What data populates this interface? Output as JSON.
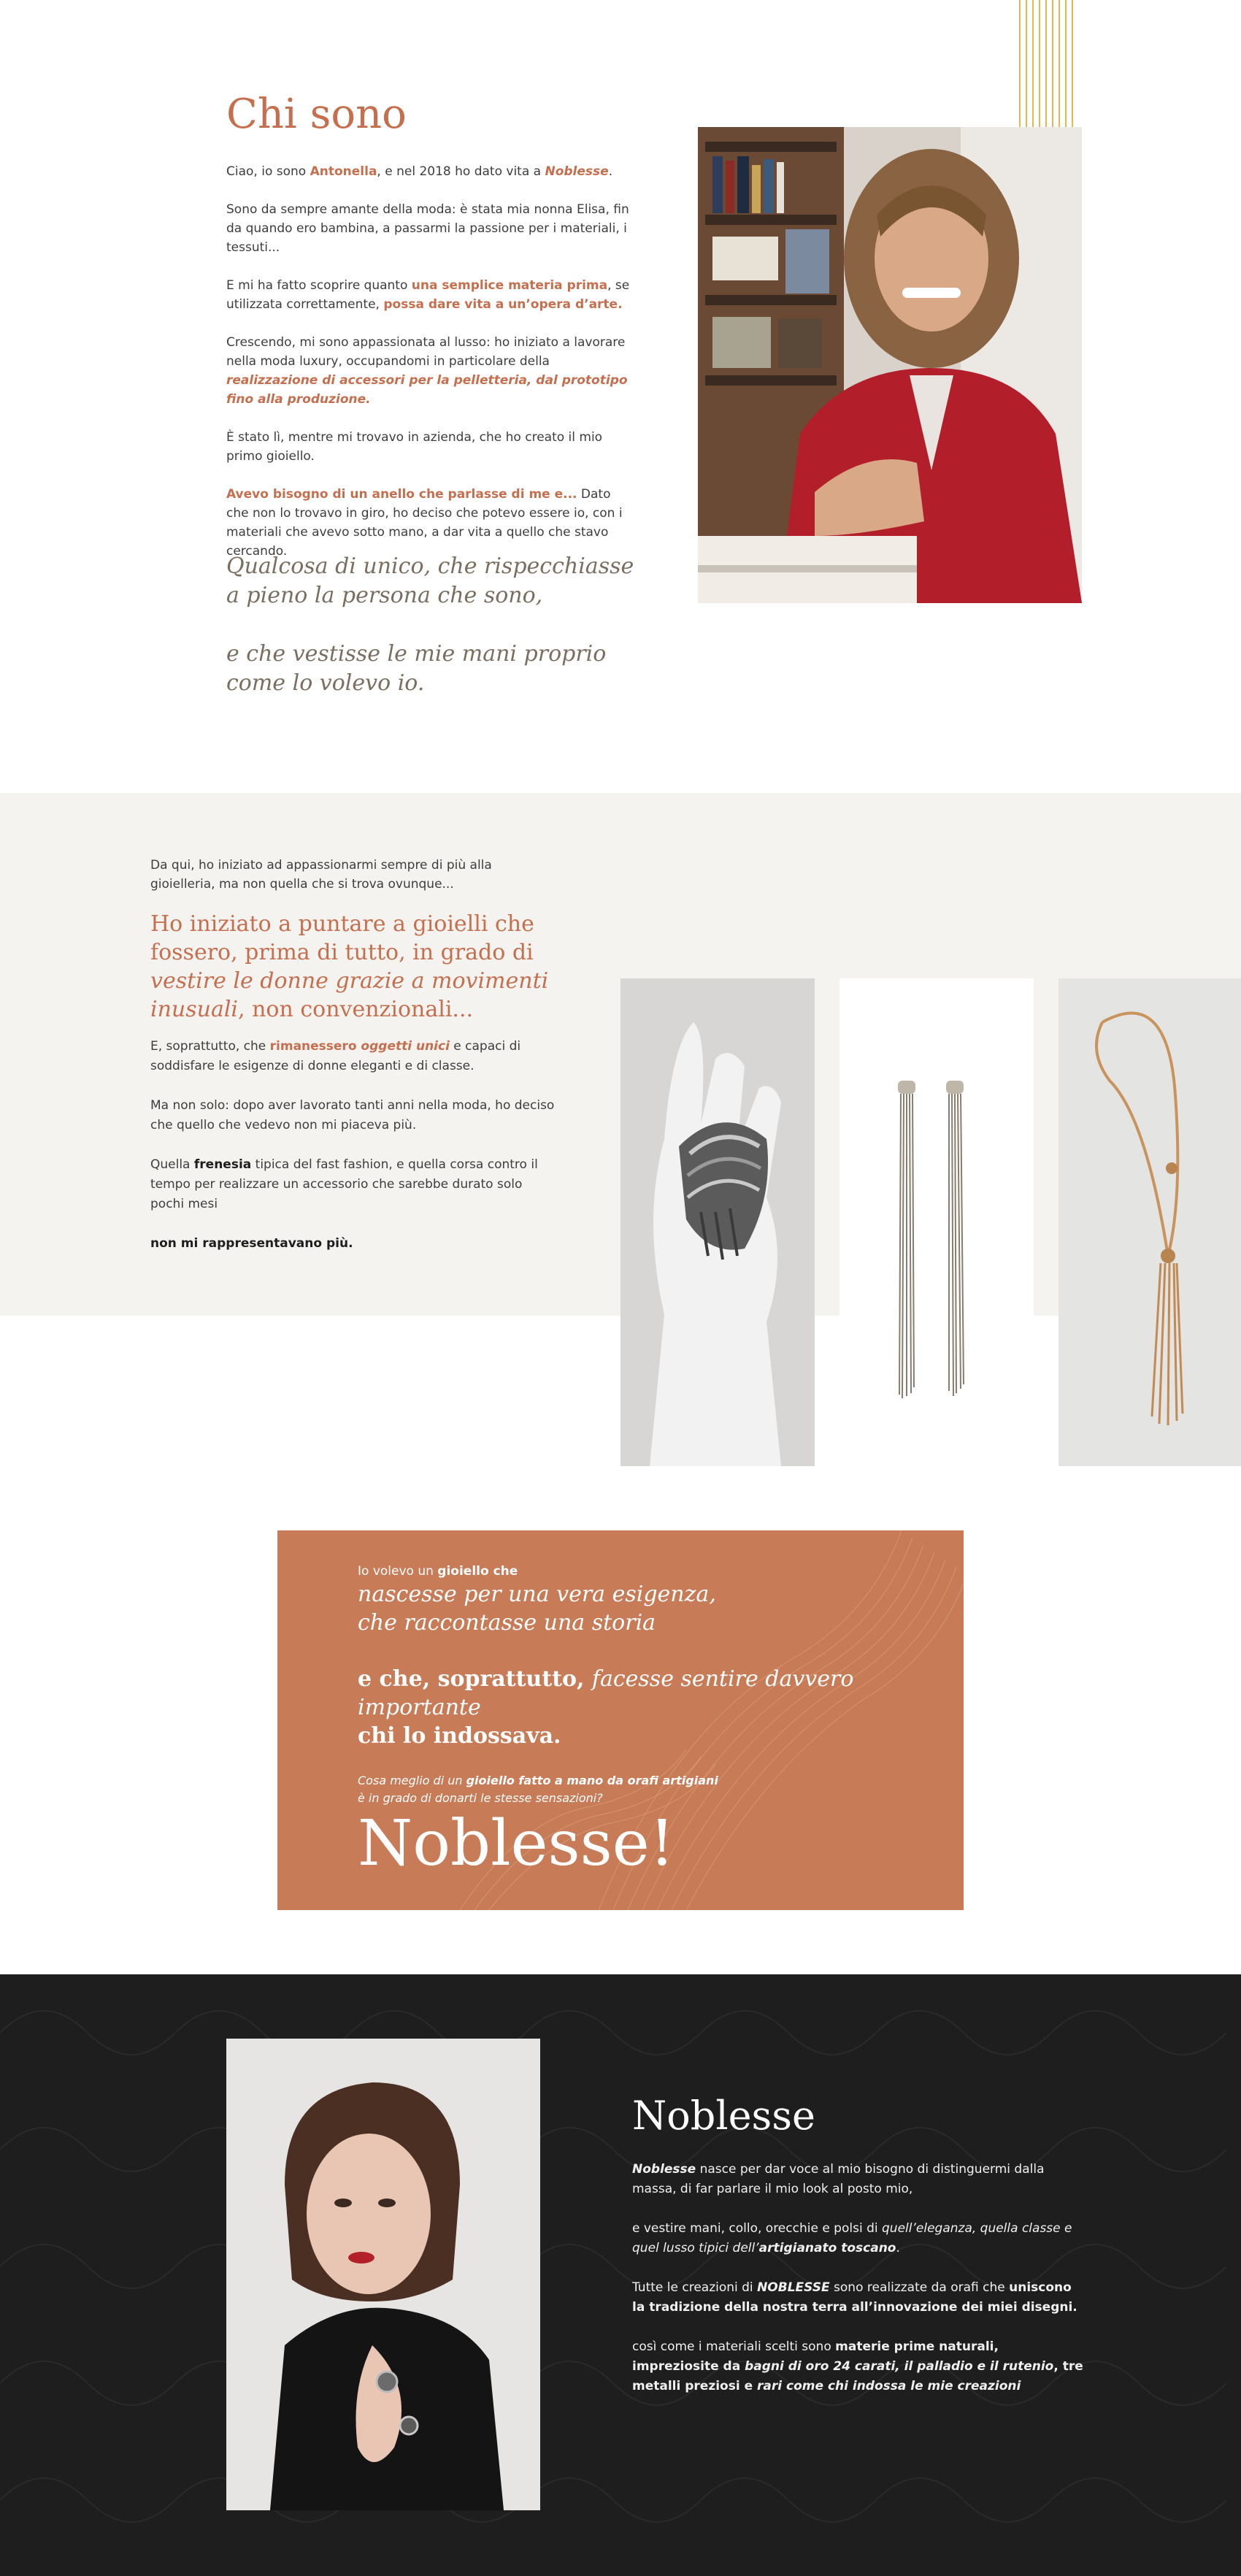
{
  "about": {
    "title": "Chi sono",
    "p1_a": "Ciao, io sono ",
    "p1_name": "Antonella",
    "p1_b": ", e nel 2018 ho dato vita a ",
    "p1_brand": "Noblesse",
    "p1_c": ".",
    "p2": "Sono da sempre amante della moda: è stata mia nonna Elisa, fin da quando ero bambina, a passarmi la passione per i materiali, i tessuti...",
    "p3_a": "E mi ha fatto scoprire quanto ",
    "p3_b": "una semplice materia prima",
    "p3_c": ", se utilizzata correttamente, ",
    "p3_d": "possa dare vita a un’opera d’arte.",
    "p4_a": "Crescendo, mi sono appassionata al lusso: ho iniziato a lavorare nella moda luxury, occupandomi in particolare della ",
    "p4_b": "realizzazione di accessori per la pelletteria, dal prototipo fino alla produzione.",
    "p5": "È stato lì, mentre mi trovavo in azienda, che ho creato il mio primo gioiello.",
    "p6_a": "Avevo bisogno di un anello che parlasse di me e...",
    "p6_b": " Dato che non lo trovavo in giro, ho deciso che potevo essere io, con i materiali che avevo sotto mano, a dar vita a quello che stavo cercando.",
    "quote1": "Qualcosa di unico, che rispecchiasse a pieno la persona che sono,",
    "quote2": "e che vestisse le mie mani proprio come lo volevo io."
  },
  "journey": {
    "intro": "Da qui, ho iniziato ad appassionarmi sempre di più alla gioielleria, ma non quella che si trova ovunque...",
    "head_a": "Ho iniziato a puntare a gioielli che fossero, prima di tutto, in grado di ",
    "head_b": "vestire le donne grazie a movimenti inusuali",
    "head_c": ", non convenzionali...",
    "b1_a": "E, soprattutto, che ",
    "b1_b": "rimanessero ",
    "b1_c": "oggetti unici",
    "b1_d": " e capaci di soddisfare le esigenze di donne eleganti e di classe.",
    "b2": "Ma non solo: dopo aver lavorato tanti anni nella moda, ho deciso che quello che vedevo non mi piaceva più.",
    "b3_a": "Quella ",
    "b3_b": "frenesia",
    "b3_c": " tipica del fast fashion, e quella corsa contro il tempo per realizzare un accessorio che sarebbe durato solo pochi mesi",
    "b4": "non mi rappresentavano più."
  },
  "banner": {
    "l1_a": "Io volevo un ",
    "l1_b": "gioiello che",
    "l2": "nascesse per una vera esigenza,",
    "l3": "che raccontasse una storia",
    "l4_a": "e che, soprattutto, ",
    "l4_b": "facesse sentire davvero importante",
    "l5": "chi lo indossava.",
    "n1_a": "Cosa meglio di un ",
    "n1_b": "gioiello fatto a mano da orafi artigiani",
    "n2": "è in grado di donarti le stesse sensazioni?",
    "brand": "Noblesse!"
  },
  "brand_section": {
    "title": "Noblesse",
    "p1_a": "Noblesse",
    "p1_b": " nasce per dar voce al mio bisogno di distinguermi dalla massa, di far parlare il mio look al posto mio,",
    "p2_a": "e vestire mani, collo, orecchie e polsi di ",
    "p2_b": "quell’eleganza, quella classe e quel lusso tipici dell’",
    "p2_c": "artigianato toscano",
    "p2_d": ".",
    "p3_a": "Tutte le creazioni di ",
    "p3_b": "NOBLESSE",
    "p3_c": " sono realizzate da orafi che ",
    "p3_d": "uniscono la tradizione della nostra terra all’innovazione dei miei disegni.",
    "p4_a": "così come i materiali scelti sono ",
    "p4_b": "materie prime naturali, impreziosite da ",
    "p4_c": "bagni di oro 24 carati, il palladio e il rutenio",
    "p4_d": ", tre metalli preziosi e ",
    "p4_e": "rari come chi indossa le mie creazioni"
  },
  "colors": {
    "accent": "#c56f4f",
    "banner": "#c77b57",
    "gold": "#e4b84f",
    "section_bg": "#f5f3f0",
    "dark": "#1e1e1e"
  }
}
